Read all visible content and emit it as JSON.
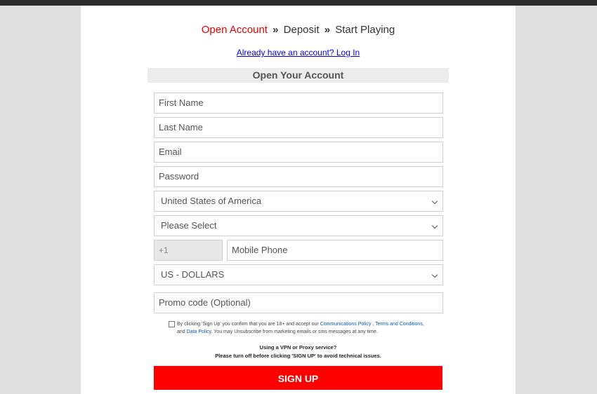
{
  "steps": {
    "step1": "Open Account",
    "step2": "Deposit",
    "step3": "Start Playing",
    "separator": "»"
  },
  "login_link": "Already have an account? Log In",
  "section_title": "Open Your Account",
  "form": {
    "first_name_placeholder": "First Name",
    "last_name_placeholder": "Last Name",
    "email_placeholder": "Email",
    "password_placeholder": "Password",
    "country_value": "United States of America",
    "state_value": "Please Select",
    "phone_prefix": "+1",
    "phone_placeholder": "Mobile Phone",
    "currency_value": "US - DOLLARS",
    "promo_placeholder": "Promo code (Optional)"
  },
  "terms": {
    "part1": "By clicking 'Sign Up' you confirm that you are 18+ and accept our ",
    "link_comms": "Communications Policy",
    "sep1": " , ",
    "link_terms": "Terms and Conditions",
    "part2": ",",
    "and": "and ",
    "link_data": "Data Policy",
    "part3": ". You may Unsubscribe from marketing emails or sms messages at any time."
  },
  "vpn": {
    "line1": "Using a VPN or Proxy service?",
    "line2": "Please turn off before clicking 'SIGN UP' to avoid technical issues."
  },
  "signup_label": "SIGN UP",
  "colors": {
    "accent_red": "#ff0000",
    "step_active": "#e40000",
    "link_blue": "#0000ee"
  }
}
